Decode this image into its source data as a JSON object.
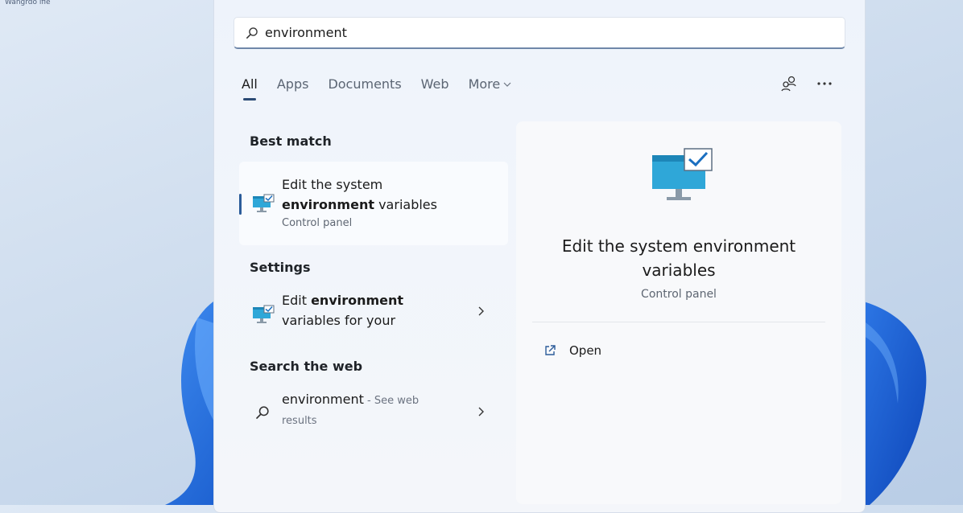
{
  "desktop": {
    "label": "Wangrdo lfie"
  },
  "search": {
    "query": "environment"
  },
  "tabs": [
    {
      "label": "All",
      "active": true
    },
    {
      "label": "Apps"
    },
    {
      "label": "Documents"
    },
    {
      "label": "Web"
    },
    {
      "label": "More"
    }
  ],
  "icons": {
    "search": "search-icon",
    "tab_more": "chevron-down-icon",
    "account_switch": "account-switch-icon",
    "more_options": "more-options-icon",
    "control_panel": "monitor-checkmark-icon",
    "chevron": "chevron-right-icon",
    "open": "open-external-icon"
  },
  "best_match": {
    "heading": "Best match",
    "title_prefix": "Edit the system",
    "title_bold": "environment",
    "title_suffix": " variables",
    "subtitle": "Control panel"
  },
  "settings": {
    "heading": "Settings",
    "item": {
      "prefix": "Edit ",
      "bold": "environment",
      "line2": "variables for your"
    }
  },
  "web": {
    "heading": "Search the web",
    "item": {
      "query": "environment",
      "suffix": " - See web",
      "line2": "results"
    }
  },
  "detail": {
    "title_line1": "Edit the system environment",
    "title_line2": "variables",
    "subtitle": "Control panel",
    "action_open": "Open"
  },
  "colors": {
    "accent": "#2c5c9a",
    "wallpaper_bloom": "#1f67d6",
    "panel": "#f1f5fb"
  }
}
